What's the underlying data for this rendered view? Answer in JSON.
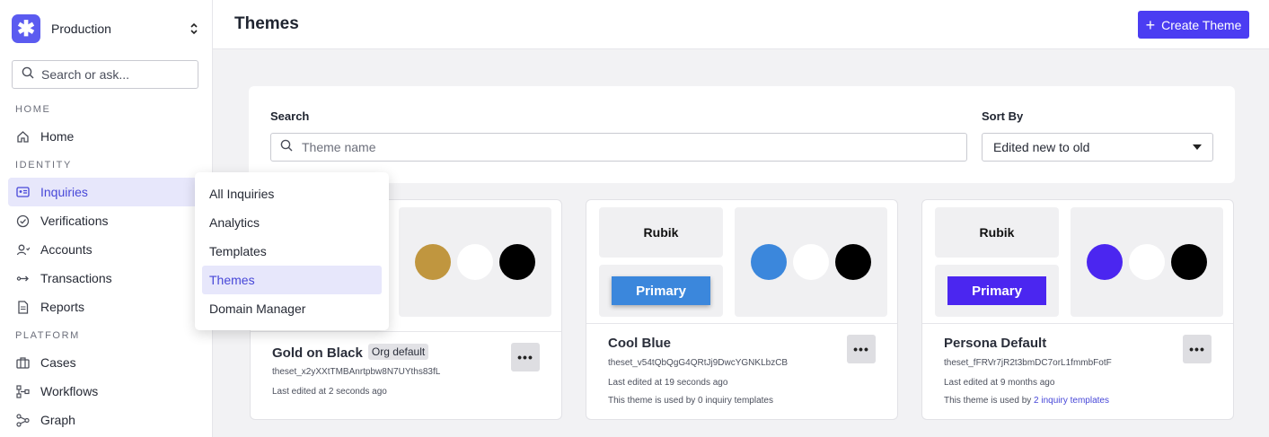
{
  "org": {
    "name": "Production",
    "logo_glyph": "✱"
  },
  "sidebar": {
    "search_placeholder": "Search or ask...",
    "sections": {
      "home": "HOME",
      "identity": "IDENTITY",
      "platform": "PLATFORM"
    },
    "items": [
      {
        "label": "Home",
        "icon": "home-icon"
      },
      {
        "label": "Inquiries",
        "icon": "id-card-icon",
        "active": true
      },
      {
        "label": "Verifications",
        "icon": "check-circle-icon"
      },
      {
        "label": "Accounts",
        "icon": "user-icon"
      },
      {
        "label": "Transactions",
        "icon": "transfer-icon"
      },
      {
        "label": "Reports",
        "icon": "document-icon"
      },
      {
        "label": "Cases",
        "icon": "briefcase-icon"
      },
      {
        "label": "Workflows",
        "icon": "workflow-icon"
      },
      {
        "label": "Graph",
        "icon": "graph-icon"
      }
    ]
  },
  "header": {
    "title": "Themes",
    "create_label": "Create Theme"
  },
  "filters": {
    "search_label": "Search",
    "search_placeholder": "Theme name",
    "sort_label": "Sort By",
    "sort_value": "Edited new to old"
  },
  "menu": {
    "items": [
      "All Inquiries",
      "Analytics",
      "Templates",
      "Themes",
      "Domain Manager"
    ],
    "active": "Themes"
  },
  "cards": [
    {
      "name": "Gold on Black",
      "badge": "Org default",
      "id": "theset_x2yXXtTMBAnrtpbw8N7UYths83fL",
      "edited": "Last edited at 2 seconds ago",
      "colors": [
        "#c0963f",
        "#ffffff",
        "#000000"
      ]
    },
    {
      "name": "Cool Blue",
      "font": "Rubik",
      "button_label": "Primary",
      "button_color": "#3b87dc",
      "id": "theset_v54tQbQgG4QRtJj9DwcYGNKLbzCB",
      "edited": "Last edited at 19 seconds ago",
      "used": "This theme is used by 0 inquiry templates",
      "colors": [
        "#3b87dc",
        "#ffffff",
        "#000000"
      ]
    },
    {
      "name": "Persona Default",
      "font": "Rubik",
      "button_label": "Primary",
      "button_color": "#4b26f0",
      "id": "theset_fFRVr7jR2t3bmDC7orL1fmmbFotF",
      "edited": "Last edited at 9 months ago",
      "used_prefix": "This theme is used by ",
      "used_link": "2 inquiry templates",
      "colors": [
        "#4b26f0",
        "#ffffff",
        "#000000"
      ]
    }
  ]
}
